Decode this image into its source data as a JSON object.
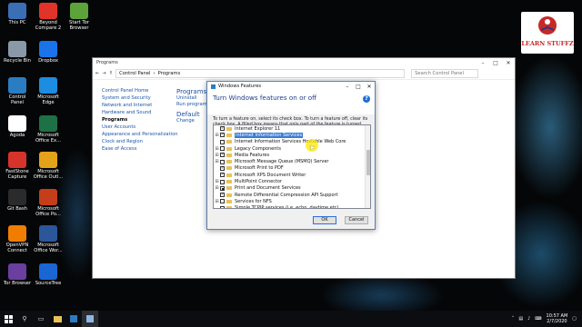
{
  "desktop": {
    "icons": [
      {
        "label": "This PC",
        "icon": "computer-icon",
        "color": "#3b6fb5"
      },
      {
        "label": "Beyond Compare 2",
        "icon": "beyond-compare-icon",
        "color": "#e0342b"
      },
      {
        "label": "Start Tor Browser",
        "icon": "tor-icon",
        "color": "#5ba33a"
      },
      {
        "label": "Recycle Bin",
        "icon": "recycle-bin-icon",
        "color": "#8a99a8"
      },
      {
        "label": "Dropbox",
        "icon": "dropbox-icon",
        "color": "#1a73e8"
      },
      {
        "label": "Control Panel",
        "icon": "control-panel-icon",
        "color": "#2a7dc2"
      },
      {
        "label": "Microsoft Edge",
        "icon": "edge-icon",
        "color": "#1c8de0"
      },
      {
        "label": "Agoda",
        "icon": "agoda-icon",
        "color": "#ffffff"
      },
      {
        "label": "Microsoft Office Ex...",
        "icon": "excel-icon",
        "color": "#1e7145"
      },
      {
        "label": "FastStone Capture",
        "icon": "faststone-icon",
        "color": "#d6342b"
      },
      {
        "label": "Microsoft Office Outl...",
        "icon": "outlook-icon",
        "color": "#e3a21a"
      },
      {
        "label": "Git Bash",
        "icon": "git-bash-icon",
        "color": "#2b2b2b"
      },
      {
        "label": "Microsoft Office Po...",
        "icon": "powerpoint-icon",
        "color": "#c43e1c"
      },
      {
        "label": "OpenVPN Connect",
        "icon": "openvpn-icon",
        "color": "#f07d00"
      },
      {
        "label": "Microsoft Office Wor...",
        "icon": "word-icon",
        "color": "#2b579a"
      },
      {
        "label": "Tor Browser",
        "icon": "tor-browser-icon",
        "color": "#6b3fa0"
      },
      {
        "label": "SourceTree",
        "icon": "sourcetree-icon",
        "color": "#1a66d2"
      }
    ]
  },
  "logo": {
    "text": "LEARN STUFFZ"
  },
  "control_panel": {
    "title": "Programs",
    "breadcrumb": [
      "Control Panel",
      "Programs"
    ],
    "search_placeholder": "Search Control Panel",
    "left_nav": [
      "Control Panel Home",
      "System and Security",
      "Network and Internet",
      "Hardware and Sound",
      "Programs",
      "User Accounts",
      "Appearance and Personalization",
      "Clock and Region",
      "Ease of Access"
    ],
    "right_items": [
      {
        "head": "Programs",
        "links": [
          "Uninstall",
          "Run programs"
        ]
      },
      {
        "head": "Default",
        "links": [
          "Change"
        ]
      }
    ]
  },
  "dialog": {
    "title": "Windows Features",
    "heading": "Turn Windows features on or off",
    "description": "To turn a feature on, select its check box. To turn a feature off, clear its check box. A filled box means that only part of the feature is turned on.",
    "features": [
      {
        "label": "Internet Explorer 11",
        "state": "checked",
        "expandable": false,
        "selected": false
      },
      {
        "label": "Internet Information Services",
        "state": "checked",
        "expandable": true,
        "selected": true
      },
      {
        "label": "Internet Information Services Hostable Web Core",
        "state": "unchecked",
        "expandable": false,
        "selected": false
      },
      {
        "label": "Legacy Components",
        "state": "unchecked",
        "expandable": true,
        "selected": false
      },
      {
        "label": "Media Features",
        "state": "checked",
        "expandable": true,
        "selected": false
      },
      {
        "label": "Microsoft Message Queue (MSMQ) Server",
        "state": "unchecked",
        "expandable": true,
        "selected": false
      },
      {
        "label": "Microsoft Print to PDF",
        "state": "checked",
        "expandable": false,
        "selected": false
      },
      {
        "label": "Microsoft XPS Document Writer",
        "state": "checked",
        "expandable": false,
        "selected": false
      },
      {
        "label": "MultiPoint Connector",
        "state": "unchecked",
        "expandable": true,
        "selected": false
      },
      {
        "label": "Print and Document Services",
        "state": "partial",
        "expandable": true,
        "selected": false
      },
      {
        "label": "Remote Differential Compression API Support",
        "state": "checked",
        "expandable": false,
        "selected": false
      },
      {
        "label": "Services for NFS",
        "state": "unchecked",
        "expandable": true,
        "selected": false
      },
      {
        "label": "Simple TCPIP services (i.e. echo, daytime etc)",
        "state": "unchecked",
        "expandable": false,
        "selected": false
      }
    ],
    "ok_label": "OK",
    "cancel_label": "Cancel"
  },
  "taskbar": {
    "time": "10:57 AM",
    "date": "2/7/2020"
  }
}
